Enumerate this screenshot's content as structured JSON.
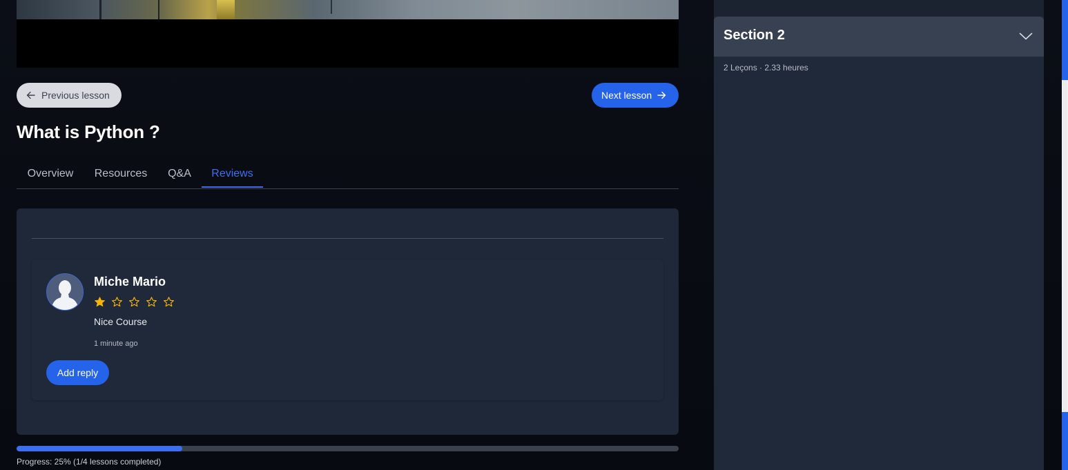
{
  "navigation": {
    "previous_label": "Previous lesson",
    "next_label": "Next lesson"
  },
  "lesson": {
    "title": "What is Python ?"
  },
  "tabs": [
    {
      "label": "Overview",
      "active": false
    },
    {
      "label": "Resources",
      "active": false
    },
    {
      "label": "Q&A",
      "active": false
    },
    {
      "label": "Reviews",
      "active": true
    }
  ],
  "review": {
    "author": "Miche Mario",
    "rating": 1,
    "max_rating": 5,
    "text": "Nice Course",
    "time_ago": "1 minute ago",
    "reply_label": "Add reply"
  },
  "progress": {
    "percent": 25,
    "text": "Progress: 25% (1/4 lessons completed)"
  },
  "sidebar": {
    "section_title": "Section 2",
    "section_meta": "2 Leçons · 2.33 heures"
  },
  "icons": {
    "prev": "arrow-left-icon",
    "next": "arrow-right-icon",
    "chevron": "chevron-down-icon",
    "star": "star-icon",
    "avatar": "user-silhouette-icon"
  },
  "colors": {
    "accent": "#2563eb",
    "star": "#f5b50a",
    "panel": "#1f2838",
    "sidebar_header": "#374151"
  }
}
